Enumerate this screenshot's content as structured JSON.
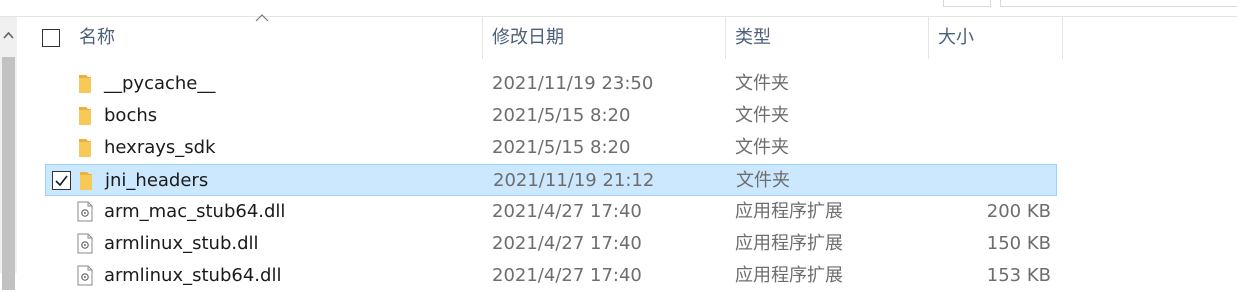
{
  "header": {
    "name": "名称",
    "modified": "修改日期",
    "type": "类型",
    "size": "大小"
  },
  "rows": [
    {
      "name": "__pycache__",
      "date": "2021/11/19 23:50",
      "type": "文件夹",
      "size": "",
      "icon": "folder-icon",
      "selected": false
    },
    {
      "name": "bochs",
      "date": "2021/5/15 8:20",
      "type": "文件夹",
      "size": "",
      "icon": "folder-icon",
      "selected": false
    },
    {
      "name": "hexrays_sdk",
      "date": "2021/5/15 8:20",
      "type": "文件夹",
      "size": "",
      "icon": "folder-icon",
      "selected": false
    },
    {
      "name": "jni_headers",
      "date": "2021/11/19 21:12",
      "type": "文件夹",
      "size": "",
      "icon": "folder-icon",
      "selected": true
    },
    {
      "name": "arm_mac_stub64.dll",
      "date": "2021/4/27 17:40",
      "type": "应用程序扩展",
      "size": "200 KB",
      "icon": "dll-file-icon",
      "selected": false
    },
    {
      "name": "armlinux_stub.dll",
      "date": "2021/4/27 17:40",
      "type": "应用程序扩展",
      "size": "150 KB",
      "icon": "dll-file-icon",
      "selected": false
    },
    {
      "name": "armlinux_stub64.dll",
      "date": "2021/4/27 17:40",
      "type": "应用程序扩展",
      "size": "153 KB",
      "icon": "dll-file-icon",
      "selected": false
    }
  ],
  "colors": {
    "selection_bg": "#cce8ff",
    "selection_border": "#99d1ff",
    "header_text": "#4c607a",
    "folder": "#f8c858"
  }
}
